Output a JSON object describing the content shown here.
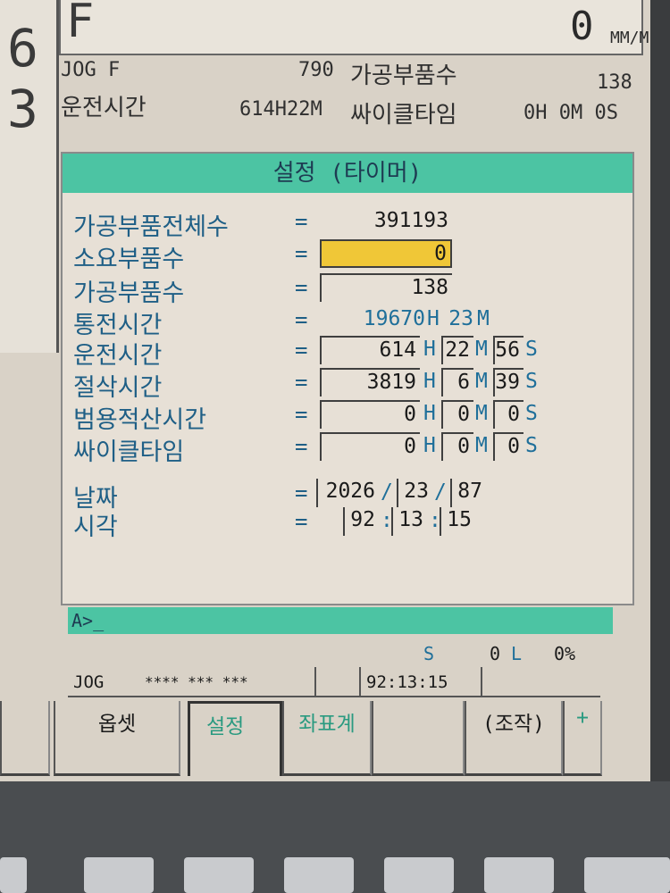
{
  "left_strip": {
    "digit_top": "6",
    "digit_bottom": "3"
  },
  "feed": {
    "label": "F",
    "value": "0",
    "unit": "MM/MIN"
  },
  "info": {
    "jog_label": "JOG F",
    "jog_value": "790",
    "parts_label": "가공부품수",
    "parts_value": "138",
    "run_label": "운전시간",
    "run_value": "614H22M",
    "cycle_label": "싸이클타임",
    "cycle_value": "0H 0M 0S"
  },
  "dialog": {
    "title": "설정 (타이머)",
    "rows": {
      "total_parts": {
        "label": "가공부품전체수",
        "eq": "=",
        "value": "391193"
      },
      "required_parts": {
        "label": "소요부품수",
        "eq": "=",
        "value": "0"
      },
      "machined_parts": {
        "label": "가공부품수",
        "eq": "=",
        "value": "138"
      },
      "power_on": {
        "label": "통전시간",
        "eq": "=",
        "hours": "19670",
        "h": "H",
        "minutes": "23",
        "m": "M"
      },
      "operating": {
        "label": "운전시간",
        "eq": "=",
        "hours": "614",
        "h": "H",
        "minutes": "22",
        "m": "M",
        "seconds": "56",
        "s": "S"
      },
      "cutting": {
        "label": "절삭시간",
        "eq": "=",
        "hours": "3819",
        "h": "H",
        "minutes": "6",
        "m": "M",
        "seconds": "39",
        "s": "S"
      },
      "general": {
        "label": "범용적산시간",
        "eq": "=",
        "hours": "0",
        "h": "H",
        "minutes": "0",
        "m": "M",
        "seconds": "0",
        "s": "S"
      },
      "cycle": {
        "label": "싸이클타임",
        "eq": "=",
        "hours": "0",
        "h": "H",
        "minutes": "0",
        "m": "M",
        "seconds": "0",
        "s": "S"
      },
      "date": {
        "label": "날짜",
        "eq": "=",
        "year": "2026",
        "sep": "/",
        "month": "23",
        "day": "87"
      },
      "time": {
        "label": "시각",
        "eq": "=",
        "hh": "92",
        "sep": ":",
        "mm": "13",
        "ss": "15"
      }
    }
  },
  "command": {
    "prompt": "A>_"
  },
  "status": {
    "s_label": "S",
    "s_value": "0",
    "l_label": "L",
    "load": "0%",
    "mode": "JOG",
    "stars": "**** *** ***",
    "clock": "92:13:15"
  },
  "softkeys": {
    "offset": "옵셋",
    "setting": "설정",
    "coord": "좌표계",
    "operation": "(조작)",
    "plus": "+"
  }
}
